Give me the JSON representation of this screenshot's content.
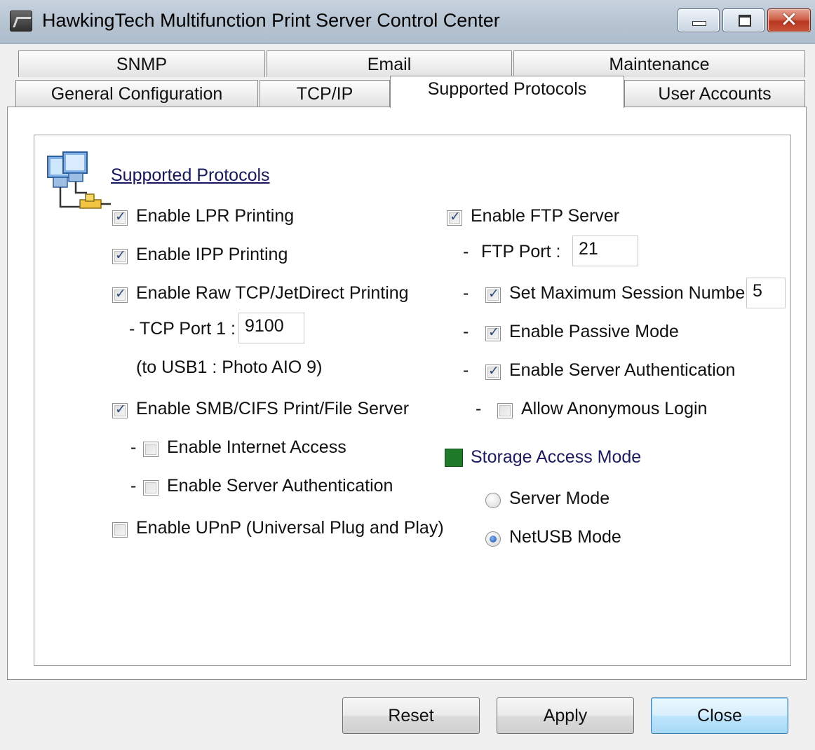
{
  "window": {
    "title": "HawkingTech Multifunction Print Server Control Center",
    "close_glyph": "✕"
  },
  "tabs": {
    "row1": [
      {
        "label": "SNMP"
      },
      {
        "label": "Email"
      },
      {
        "label": "Maintenance"
      }
    ],
    "row2": [
      {
        "label": "General Configuration"
      },
      {
        "label": "TCP/IP"
      },
      {
        "label": "Supported Protocols",
        "active": true
      },
      {
        "label": "User Accounts"
      }
    ]
  },
  "section": {
    "title": "Supported Protocols"
  },
  "left": {
    "lpr": {
      "label": "Enable LPR Printing",
      "checked": true
    },
    "ipp": {
      "label": "Enable IPP Printing",
      "checked": true
    },
    "raw": {
      "label": "Enable Raw TCP/JetDirect Printing",
      "checked": true
    },
    "tcp_port_label": "- TCP Port 1 :",
    "tcp_port_value": "9100",
    "usb_note": "(to USB1 :  Photo AIO 9)",
    "smb": {
      "label": "Enable SMB/CIFS Print/File Server",
      "checked": true
    },
    "smb_internet": {
      "label": "Enable Internet Access",
      "checked": false
    },
    "smb_auth": {
      "label": "Enable Server Authentication",
      "checked": false
    },
    "upnp": {
      "label": "Enable UPnP (Universal Plug and Play)",
      "checked": false
    }
  },
  "right": {
    "ftp": {
      "label": "Enable FTP Server",
      "checked": true
    },
    "ftp_port_label": "FTP Port :",
    "ftp_port_value": "21",
    "max_session": {
      "label": "Set Maximum Session Number",
      "checked": true,
      "value": "5"
    },
    "passive": {
      "label": "Enable Passive Mode",
      "checked": true
    },
    "server_auth": {
      "label": "Enable Server Authentication",
      "checked": true
    },
    "anonymous": {
      "label": "Allow Anonymous Login",
      "checked": false
    },
    "storage_mode_label": "Storage Access Mode",
    "storage_color": "#1f7a2a",
    "modes": [
      {
        "label": "Server Mode",
        "selected": false
      },
      {
        "label": "NetUSB Mode",
        "selected": true
      }
    ]
  },
  "dash": "-",
  "buttons": {
    "reset": "Reset",
    "apply": "Apply",
    "close": "Close"
  }
}
